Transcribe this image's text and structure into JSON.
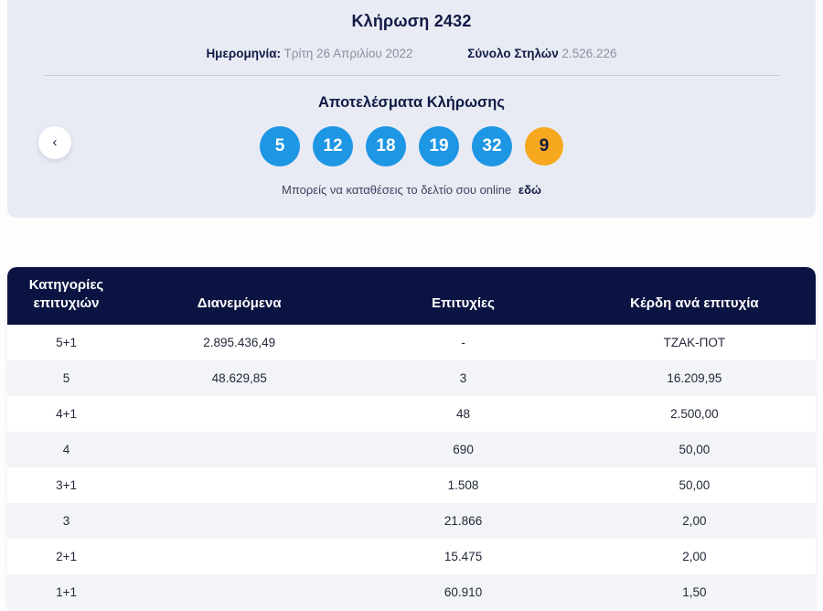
{
  "colors": {
    "navy": "#0a1341",
    "card_bg": "#e9ebf4",
    "ball_blue": "#1d96e4",
    "ball_yellow": "#f6a81e",
    "row_alt": "#f3f4f7",
    "muted_text": "#8b90a0"
  },
  "draw_card": {
    "title": "Κλήρωση 2432",
    "date_label": "Ημερομηνία:",
    "date_value": "Τρίτη 26 Απριλίου 2022",
    "columns_label": "Σύνολο Στηλών",
    "columns_value": "2.526.226",
    "results_heading": "Αποτελέσματα Κλήρωσης",
    "back_icon": "‹",
    "numbers": [
      "5",
      "12",
      "18",
      "19",
      "32"
    ],
    "bonus_number": "9",
    "footer_text": "Μπορείς να καταθέσεις το δελτίο σου online",
    "footer_link": "εδώ"
  },
  "table": {
    "headers": [
      "Κατηγορίες επιτυχιών",
      "Διανεμόμενα",
      "Επιτυχίες",
      "Κέρδη ανά επιτυχία"
    ],
    "rows": [
      {
        "category": "5+1",
        "distributed": "2.895.436,49",
        "winners": "-",
        "payout": "ΤΖΑΚ-ΠΟΤ"
      },
      {
        "category": "5",
        "distributed": "48.629,85",
        "winners": "3",
        "payout": "16.209,95"
      },
      {
        "category": "4+1",
        "distributed": "",
        "winners": "48",
        "payout": "2.500,00"
      },
      {
        "category": "4",
        "distributed": "",
        "winners": "690",
        "payout": "50,00"
      },
      {
        "category": "3+1",
        "distributed": "",
        "winners": "1.508",
        "payout": "50,00"
      },
      {
        "category": "3",
        "distributed": "",
        "winners": "21.866",
        "payout": "2,00"
      },
      {
        "category": "2+1",
        "distributed": "",
        "winners": "15.475",
        "payout": "2,00"
      },
      {
        "category": "1+1",
        "distributed": "",
        "winners": "60.910",
        "payout": "1,50"
      }
    ]
  }
}
